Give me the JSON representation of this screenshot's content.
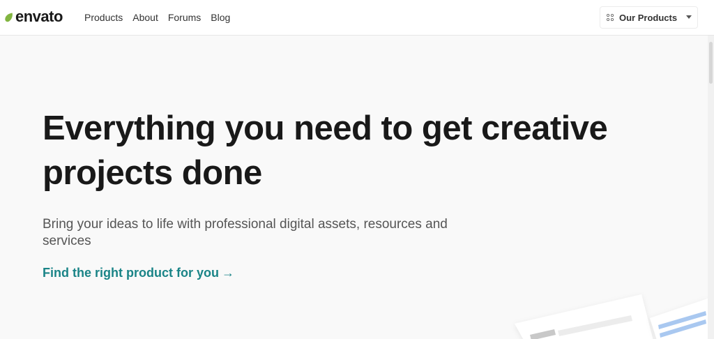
{
  "header": {
    "logo_text": "envato",
    "nav": [
      {
        "label": "Products"
      },
      {
        "label": "About"
      },
      {
        "label": "Forums"
      },
      {
        "label": "Blog"
      }
    ],
    "our_products_label": "Our Products"
  },
  "hero": {
    "title_line1": "Everything you need to get creative",
    "title_line2": "projects done",
    "subtitle": "Bring your ideas to life with professional digital assets, resources and services",
    "cta_label": "Find the right product for you",
    "cta_arrow": "→"
  },
  "colors": {
    "accent": "#1a8487",
    "brand_green": "#82b541",
    "text_dark": "#191919",
    "background": "#f9f9f9"
  },
  "icons": {
    "logo": "envato-leaf-icon",
    "our_products": "grid-icon",
    "dropdown": "caret-down-icon",
    "cta": "arrow-right-icon"
  }
}
